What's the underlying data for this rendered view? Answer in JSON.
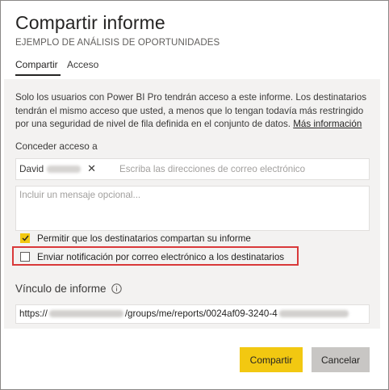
{
  "dialog": {
    "title": "Compartir informe",
    "subtitle": "EJEMPLO DE ANÁLISIS DE OPORTUNIDADES"
  },
  "tabs": [
    {
      "label": "Compartir",
      "active": true
    },
    {
      "label": "Acceso",
      "active": false
    }
  ],
  "info": {
    "text": "Solo los usuarios con Power BI Pro tendrán acceso a este informe. Los destinatarios tendrán el mismo acceso que usted, a menos que lo tengan todavía más restringido por una seguridad de nivel de fila definida en el conjunto de datos.",
    "link_label": "Más información"
  },
  "grant_access": {
    "label": "Conceder acceso a",
    "recipient_chip": "David",
    "remove_icon": "close-icon",
    "placeholder": "Escriba las direcciones de correo electrónico"
  },
  "message": {
    "placeholder": "Incluir un mensaje opcional..."
  },
  "options": [
    {
      "label": "Permitir que los destinatarios compartan su informe",
      "checked": true
    },
    {
      "label": "Enviar notificación por correo electrónico a los destinatarios",
      "checked": false
    }
  ],
  "report_link": {
    "label": "Vínculo de informe",
    "info_icon": "info-icon",
    "url_prefix": "https://",
    "url_middle": "/groups/me/reports/0024af09-3240-4"
  },
  "buttons": {
    "share": "Compartir",
    "cancel": "Cancelar"
  },
  "colors": {
    "accent": "#f2c811",
    "highlight": "#d9393a",
    "panel": "#f3f2f1"
  }
}
